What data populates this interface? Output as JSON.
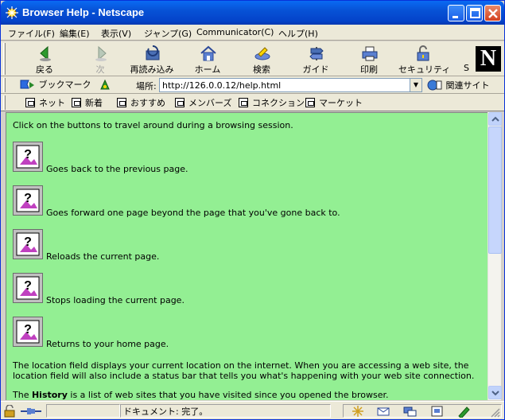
{
  "window": {
    "title": "Browser Help - Netscape"
  },
  "menu": [
    "ファイル(F)",
    "編集(E)",
    "表示(V)",
    "ジャンプ(G)",
    "Communicator(C)",
    "ヘルプ(H)"
  ],
  "nav": {
    "back": "戻る",
    "forward": "次",
    "reload": "再読み込み",
    "home": "ホーム",
    "search": "検索",
    "guide": "ガイド",
    "print": "印刷",
    "security": "セキュリティ",
    "stop": "S"
  },
  "location": {
    "bookmarks": "ブックマーク",
    "label": "場所:",
    "url": "http://126.0.0.12/help.html",
    "related": "関連サイト"
  },
  "links": [
    "ネット",
    "新着",
    "おすすめ",
    "メンバーズ",
    "コネクション",
    "マーケット"
  ],
  "content": {
    "intro": "Click on the buttons to travel around during a browsing session.",
    "items": [
      "Goes back to the previous page.",
      "Goes forward one page beyond the page that you've gone back to.",
      "Reloads the current page.",
      "Stops loading the current page.",
      "Returns to your home page."
    ],
    "location_line1": "The location field displays your current location on the internet. When you are accessing a web site, the",
    "location_line2": "location field will also include a status bar that tells you what's happening with your web site connection.",
    "history_pre": "The ",
    "history_bold": "History",
    "history_post": " is a list of web sites that you have visited since you opened the browser."
  },
  "status": {
    "text": "ドキュメント: 完了。"
  },
  "colors": {
    "content_bg": "#93ef93",
    "titlebar": "#0752d6"
  }
}
